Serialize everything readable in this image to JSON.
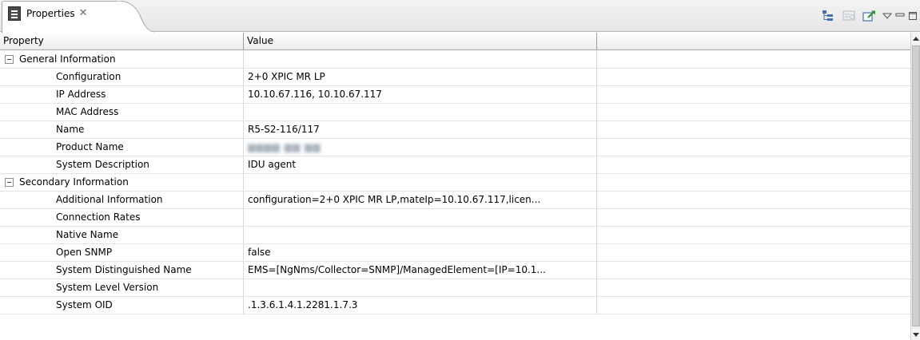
{
  "view": {
    "tab_label": "Properties",
    "close_glyph": "✕",
    "icon": "properties-view-icon"
  },
  "toolbar": {
    "buttons": [
      "show-categories-icon",
      "show-advanced-icon",
      "restore-default-icon",
      "view-menu-icon",
      "minimize-icon",
      "maximize-icon"
    ]
  },
  "table": {
    "headers": {
      "property": "Property",
      "value": "Value",
      "extra": ""
    },
    "rows": [
      {
        "kind": "category",
        "property": "General Information",
        "value": ""
      },
      {
        "kind": "child",
        "property": "Configuration",
        "value": "2+0 XPIC MR LP"
      },
      {
        "kind": "child",
        "property": "IP Address",
        "value": "10.10.67.116, 10.10.67.117"
      },
      {
        "kind": "child",
        "property": "MAC Address",
        "value": ""
      },
      {
        "kind": "child",
        "property": "Name",
        "value": "R5-S2-116/117"
      },
      {
        "kind": "child",
        "property": "Product Name",
        "value": "",
        "blurred": true
      },
      {
        "kind": "child",
        "property": "System Description",
        "value": "IDU agent"
      },
      {
        "kind": "category",
        "property": "Secondary Information",
        "value": ""
      },
      {
        "kind": "child",
        "property": "Additional Information",
        "value": "configuration=2+0 XPIC MR LP,mateIp=10.10.67.117,licen..."
      },
      {
        "kind": "child",
        "property": "Connection Rates",
        "value": ""
      },
      {
        "kind": "child",
        "property": "Native Name",
        "value": ""
      },
      {
        "kind": "child",
        "property": "Open SNMP",
        "value": "false"
      },
      {
        "kind": "child",
        "property": "System Distinguished Name",
        "value": "EMS=[NgNms/Collector=SNMP]/ManagedElement=[IP=10.1..."
      },
      {
        "kind": "child",
        "property": "System Level Version",
        "value": ""
      },
      {
        "kind": "child",
        "property": "System OID",
        "value": ".1.3.6.1.4.1.2281.1.7.3"
      }
    ]
  },
  "colors": {
    "header_border": "#9c9c9c",
    "row_divider": "#e2e2e2"
  }
}
